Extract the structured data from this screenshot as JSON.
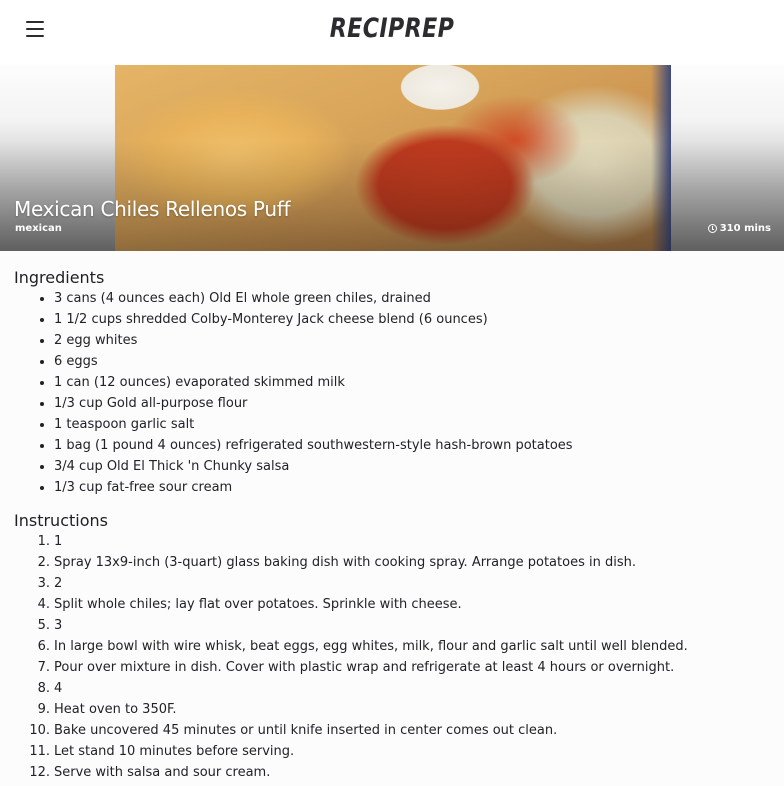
{
  "app": {
    "logo": "RECIPREP",
    "menu_icon": "hamburger-menu-icon"
  },
  "recipe": {
    "title": "Mexican Chiles Rellenos Puff",
    "cuisine": "mexican",
    "time": "310 mins",
    "time_icon": "clock-icon"
  },
  "ingredients": {
    "heading": "Ingredients",
    "items": [
      "3 cans (4 ounces each) Old El whole green chiles, drained",
      "1 1/2 cups shredded Colby-Monterey Jack cheese blend (6 ounces)",
      "2 egg whites",
      "6 eggs",
      "1 can (12 ounces) evaporated skimmed milk",
      "1/3 cup Gold all-purpose flour",
      "1 teaspoon garlic salt",
      "1 bag (1 pound 4 ounces) refrigerated southwestern-style hash-brown potatoes",
      "3/4 cup Old El Thick 'n Chunky salsa",
      "1/3 cup fat-free sour cream"
    ]
  },
  "instructions": {
    "heading": "Instructions",
    "steps": [
      {
        "num": "1.",
        "text": "1"
      },
      {
        "num": "2.",
        "text": "Spray 13x9-inch (3-quart) glass baking dish with cooking spray. Arrange potatoes in dish."
      },
      {
        "num": "3.",
        "text": "2"
      },
      {
        "num": "4.",
        "text": "Split whole chiles; lay flat over potatoes. Sprinkle with cheese."
      },
      {
        "num": "5.",
        "text": "3"
      },
      {
        "num": "6.",
        "text": "In large bowl with wire whisk, beat eggs, egg whites, milk, flour and garlic salt until well blended."
      },
      {
        "num": "7.",
        "text": "Pour over mixture in dish. Cover with plastic wrap and refrigerate at least 4 hours or overnight."
      },
      {
        "num": "8.",
        "text": "4"
      },
      {
        "num": "9.",
        "text": "Heat oven to 350F."
      },
      {
        "num": "10.",
        "text": "Bake uncovered 45 minutes or until knife inserted in center comes out clean."
      },
      {
        "num": "11.",
        "text": "Let stand 10 minutes before serving."
      },
      {
        "num": "12.",
        "text": "Serve with salsa and sour cream."
      }
    ]
  }
}
